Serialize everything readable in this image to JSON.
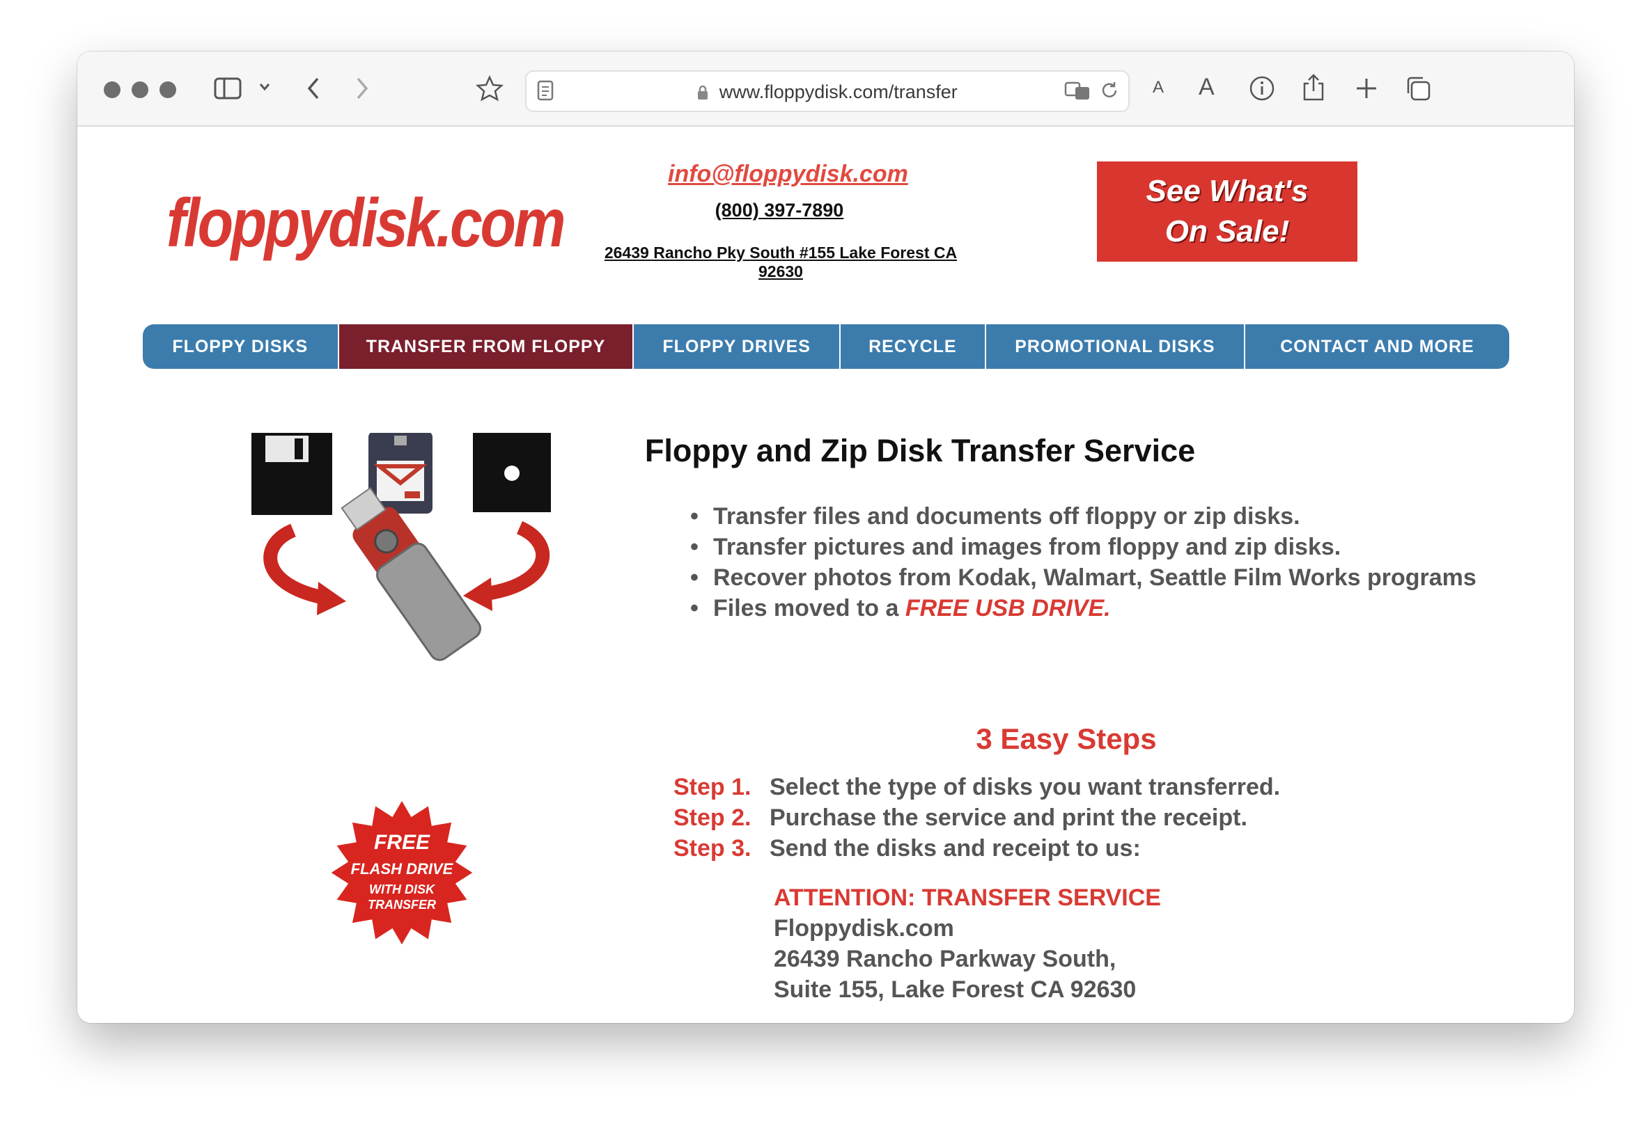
{
  "browser": {
    "url": "www.floppydisk.com/transfer"
  },
  "header": {
    "logo": "floppydisk.com",
    "email": "info@floppydisk.com",
    "phone": "(800) 397-7890",
    "address": "26439 Rancho Pky South #155 Lake Forest CA 92630",
    "sale_line1": "See What's",
    "sale_line2": "On Sale!"
  },
  "nav": {
    "items": [
      {
        "label": "FLOPPY DISKS"
      },
      {
        "label": "TRANSFER FROM FLOPPY"
      },
      {
        "label": "FLOPPY DRIVES"
      },
      {
        "label": "RECYCLE"
      },
      {
        "label": "PROMOTIONAL DISKS"
      },
      {
        "label": "CONTACT AND MORE"
      }
    ],
    "active_color": "#7a1f2c",
    "bar_color": "#3c7cad"
  },
  "main": {
    "title": "Floppy and Zip Disk Transfer Service",
    "bullets": [
      "Transfer files and documents off floppy or zip disks.",
      "Transfer pictures and images from floppy and zip disks.",
      "Recover photos from Kodak, Walmart, Seattle Film Works programs",
      "Files moved to a "
    ],
    "bullet_highlight": "FREE USB DRIVE.",
    "steps_title": "3 Easy Steps",
    "steps": [
      {
        "num": "Step 1.",
        "text": "Select the type of disks you want transferred."
      },
      {
        "num": "Step 2.",
        "text": "Purchase the service and print the receipt."
      },
      {
        "num": "Step 3.",
        "text": "Send the disks and receipt to us:"
      }
    ],
    "mailing": {
      "attention": "ATTENTION: TRANSFER SERVICE",
      "line1": "Floppydisk.com",
      "line2": "26439 Rancho Parkway South,",
      "line3": "Suite 155, Lake Forest CA 92630"
    }
  },
  "badge": {
    "line1": "FREE",
    "line2": "FLASH DRIVE",
    "line3": "WITH DISK",
    "line4": "TRANSFER"
  },
  "colors": {
    "brand_red": "#d83a33",
    "text_gray": "#555555"
  }
}
